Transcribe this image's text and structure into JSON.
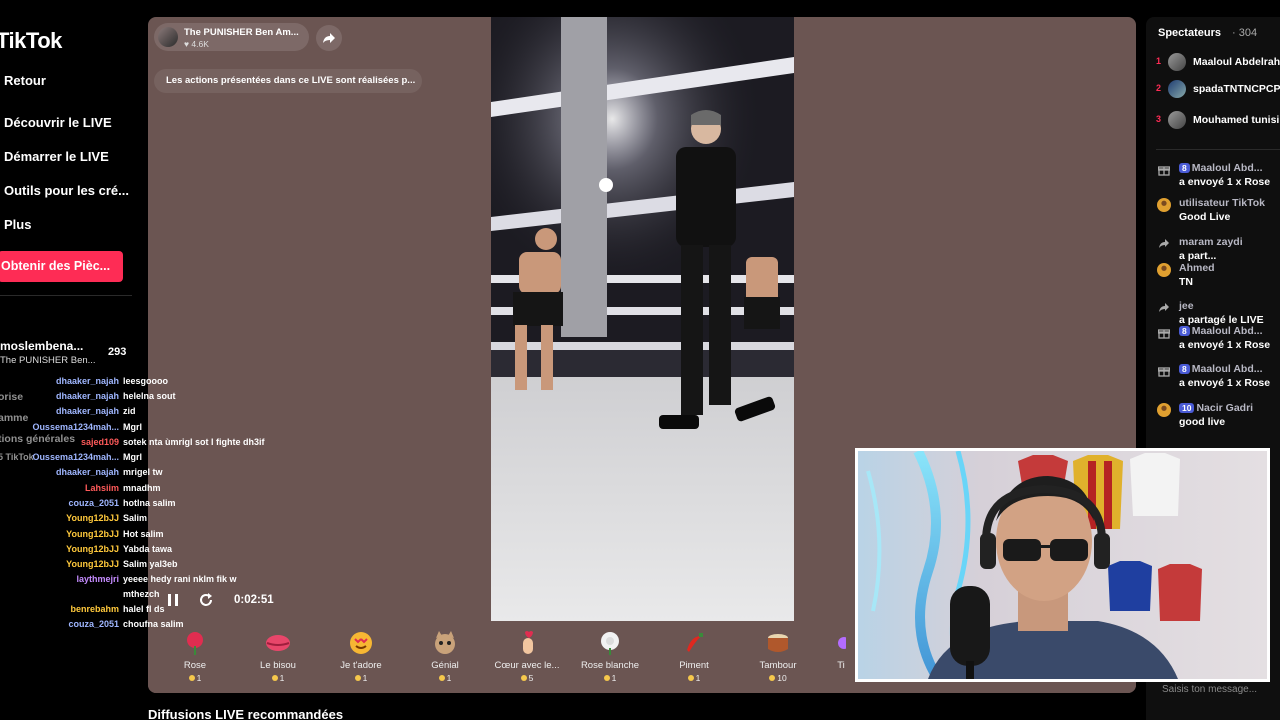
{
  "sidebar": {
    "logo": "TikTok",
    "nav": [
      {
        "label": "Retour",
        "icon": "back-icon"
      },
      {
        "label": "Découvrir le LIVE"
      },
      {
        "label": "Démarrer le LIVE"
      },
      {
        "label": "Outils pour les cré..."
      },
      {
        "label": "Plus"
      }
    ],
    "coins_button": "Obtenir des Pièc...",
    "host": {
      "name": "moslembena...",
      "subtitle": "The PUNISHER Ben...",
      "count": "293"
    },
    "ghost": [
      "orise",
      "amme",
      "tions générales",
      "5 TikTok"
    ]
  },
  "player": {
    "host_name": "The PUNISHER Ben Am...",
    "likes": "4.6K",
    "notice": "Les actions présentées dans ce LIVE sont réalisées p...",
    "time": "0:02:51",
    "accent_bg": "#6b5552"
  },
  "chat": [
    {
      "user": "dhaaker_najah",
      "msg": "leesgoooo",
      "color": "#9fb6ff"
    },
    {
      "user": "dhaaker_najah",
      "msg": "helelna sout",
      "color": "#9fb6ff"
    },
    {
      "user": "dhaaker_najah",
      "msg": "zid",
      "color": "#9fb6ff"
    },
    {
      "user": "Oussema1234mah...",
      "msg": "Mgrl",
      "color": "#9fb6ff"
    },
    {
      "user": "sajed109",
      "msg": "sotek nta ùmrigl sot l fighte dh3if",
      "color": "#ff5a5a"
    },
    {
      "user": "Oussema1234mah...",
      "msg": "Mgrl",
      "color": "#9fb6ff"
    },
    {
      "user": "dhaaker_najah",
      "msg": "mrigel tw",
      "color": "#9fb6ff"
    },
    {
      "user": "Lahsiim",
      "msg": "mnadhm",
      "color": "#ff5a5a"
    },
    {
      "user": "couza_2051",
      "msg": "hotlna salim",
      "color": "#9fb6ff"
    },
    {
      "user": "Young12bJJ",
      "msg": "Salim",
      "color": "#ffc93c"
    },
    {
      "user": "Young12bJJ",
      "msg": "Hot salim",
      "color": "#ffc93c"
    },
    {
      "user": "Young12bJJ",
      "msg": "Yabda tawa",
      "color": "#ffc93c"
    },
    {
      "user": "Young12bJJ",
      "msg": "Salim yal3eb",
      "color": "#ffc93c"
    },
    {
      "user": "laythmejri",
      "msg": "yeeee hedy rani nklm fik w",
      "color": "#c58cff"
    },
    {
      "user": "",
      "msg": "mthezch",
      "color": "#ffffff"
    },
    {
      "user": "benrebahm",
      "msg": "halel fl ds",
      "color": "#ffc93c"
    },
    {
      "user": "couza_2051",
      "msg": "choufna salim",
      "color": "#9fb6ff"
    }
  ],
  "gifts": [
    {
      "name": "Rose",
      "price": "1",
      "icon": "rose-icon"
    },
    {
      "name": "Le bisou",
      "price": "1",
      "icon": "lips-icon"
    },
    {
      "name": "Je t'adore",
      "price": "1",
      "icon": "heart-face-icon"
    },
    {
      "name": "Génial",
      "price": "1",
      "icon": "cat-icon"
    },
    {
      "name": "Cœur avec le...",
      "price": "5",
      "icon": "finger-heart-icon"
    },
    {
      "name": "Rose blanche",
      "price": "1",
      "icon": "white-rose-icon"
    },
    {
      "name": "Piment",
      "price": "1",
      "icon": "pepper-icon"
    },
    {
      "name": "Tambour",
      "price": "10",
      "icon": "drum-icon"
    },
    {
      "name": "Ti",
      "price": "",
      "icon": "gift-icon"
    }
  ],
  "recommended_title": "Diffusions LIVE recommandées",
  "right_panel": {
    "title": "Spectateurs",
    "count": "· 304",
    "top": [
      {
        "rank": "1",
        "name": "Maaloul Abdelrah"
      },
      {
        "rank": "2",
        "name": "spadaTNTNCPCP"
      },
      {
        "rank": "3",
        "name": "Mouhamed tunisi"
      }
    ],
    "feed": [
      {
        "icon": "gift-icon",
        "line1": "Maaloul Abd...",
        "badge": "8",
        "line2": "a envoyé 1 x Rose"
      },
      {
        "icon": "avatar",
        "line1": "utilisateur TikTok",
        "badge": "",
        "line2": "Good Live"
      },
      {
        "icon": "share-icon",
        "line1": "maram zaydi",
        "badge": "",
        "line2": "a part..."
      },
      {
        "icon": "avatar",
        "line1": "Ahmed",
        "badge": "",
        "line2": "TN"
      },
      {
        "icon": "share-icon",
        "line1": "jee",
        "badge": "",
        "line2": "a partagé le LIVE"
      },
      {
        "icon": "gift-icon",
        "line1": "Maaloul Abd...",
        "badge": "8",
        "line2": "a envoyé 1 x Rose"
      },
      {
        "icon": "gift-icon",
        "line1": "Maaloul Abd...",
        "badge": "8",
        "line2": "a envoyé 1 x Rose"
      },
      {
        "icon": "avatar",
        "line1": "Nacir Gadri",
        "badge": "10",
        "line2": "good live"
      }
    ],
    "input_placeholder": "Saisis ton message..."
  }
}
